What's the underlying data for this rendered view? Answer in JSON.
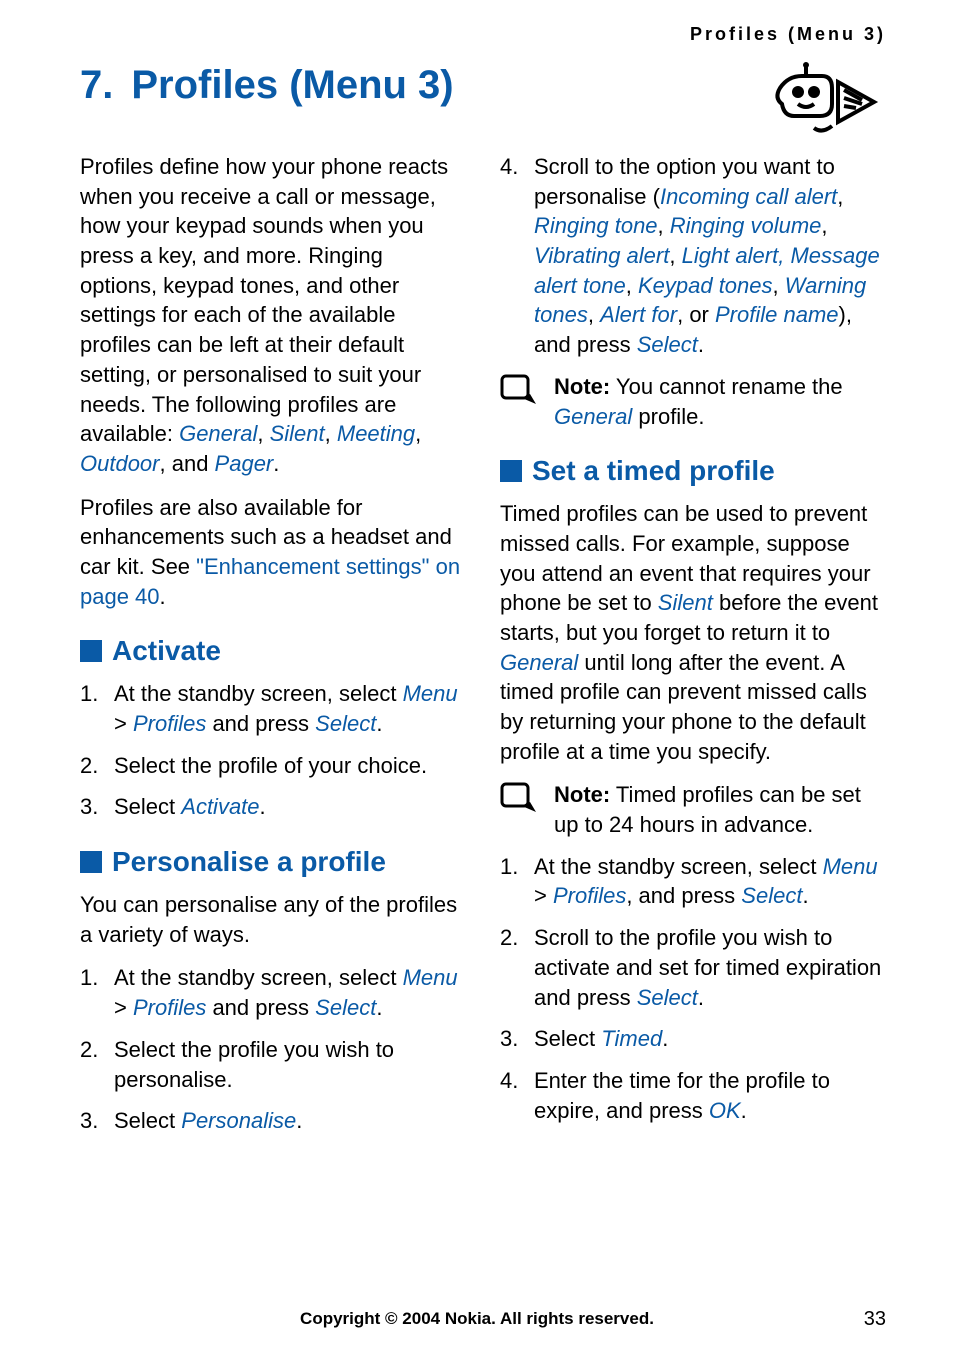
{
  "header": "Profiles (Menu 3)",
  "chapter": {
    "number": "7.",
    "title": "Profiles (Menu 3)"
  },
  "left": {
    "intro1_a": "Profiles define how your phone reacts when you receive a call or message, how your keypad sounds when you press a key, and more. Ringing options, keypad tones, and other settings for each of the available profiles can be left at their default setting, or personalised to suit your needs. The following profiles are available: ",
    "intro1_general": "General",
    "intro1_silent": "Silent",
    "intro1_meeting": "Meeting",
    "intro1_outdoor": "Outdoor",
    "intro1_and": ", and ",
    "intro1_pager": "Pager",
    "intro2_a": "Profiles are also available for enhancements such as a headset and car kit. See ",
    "intro2_link": "\"Enhancement settings\" on page 40",
    "sec1_title": "Activate",
    "sec1_step1_a": "At the standby screen, select ",
    "sec1_step1_menu": "Menu",
    "sec1_step1_gt": " > ",
    "sec1_step1_profiles": "Profiles",
    "sec1_step1_b": " and press ",
    "sec1_step1_select": "Select",
    "sec1_step2": "Select the profile of your choice.",
    "sec1_step3_a": "Select ",
    "sec1_step3_activate": "Activate",
    "sec2_title": "Personalise a profile",
    "sec2_intro": "You can personalise any of the profiles a variety of ways.",
    "sec2_step1_a": "At the standby screen, select ",
    "sec2_step1_menu": "Menu",
    "sec2_step1_gt": " > ",
    "sec2_step1_profiles": "Profiles",
    "sec2_step1_b": " and press ",
    "sec2_step1_select": "Select",
    "sec2_step2": "Select the profile you wish to personalise.",
    "sec2_step3_a": "Select ",
    "sec2_step3_personalise": "Personalise"
  },
  "right": {
    "step4_a": "Scroll to the option you want to personalise (",
    "step4_incoming": "Incoming call alert",
    "step4_ringtone": "Ringing tone",
    "step4_ringvol": "Ringing volume",
    "step4_vibrating": "Vibrating alert",
    "step4_light": "Light alert,",
    "step4_msgtone": "Message alert tone",
    "step4_keypad": "Keypad tones",
    "step4_warning": "Warning tones",
    "step4_alertfor": "Alert for",
    "step4_or": ", or ",
    "step4_profilename": "Profile name",
    "step4_b": "), and press ",
    "step4_select": "Select",
    "note1_label": "Note:",
    "note1_a": " You cannot rename the ",
    "note1_general": "General",
    "note1_b": " profile.",
    "sec3_title": "Set a timed profile",
    "sec3_intro_a": "Timed profiles can be used to prevent missed calls. For example, suppose you attend an event that requires your phone be set to ",
    "sec3_intro_silent": "Silent",
    "sec3_intro_b": " before the event starts, but you forget to return it to ",
    "sec3_intro_general": "General",
    "sec3_intro_c": " until long after the event. A timed profile can prevent missed calls by returning your phone to the default profile at a time you specify.",
    "note2_label": "Note:",
    "note2_text": " Timed profiles can be set up to 24 hours in advance.",
    "sec3_step1_a": "At the standby screen, select ",
    "sec3_step1_menu": "Menu",
    "sec3_step1_gt": " > ",
    "sec3_step1_profiles": "Profiles",
    "sec3_step1_b": ", and press ",
    "sec3_step1_select": "Select",
    "sec3_step2_a": "Scroll to the profile you wish to activate and set for timed expiration and press ",
    "sec3_step2_select": "Select",
    "sec3_step3_a": "Select ",
    "sec3_step3_timed": "Timed",
    "sec3_step4_a": "Enter the time for the profile to expire, and press ",
    "sec3_step4_ok": "OK"
  },
  "footer": {
    "copyright": "Copyright © 2004 Nokia. All rights reserved.",
    "page": "33"
  },
  "nums": {
    "n1": "1.",
    "n2": "2.",
    "n3": "3.",
    "n4": "4."
  }
}
